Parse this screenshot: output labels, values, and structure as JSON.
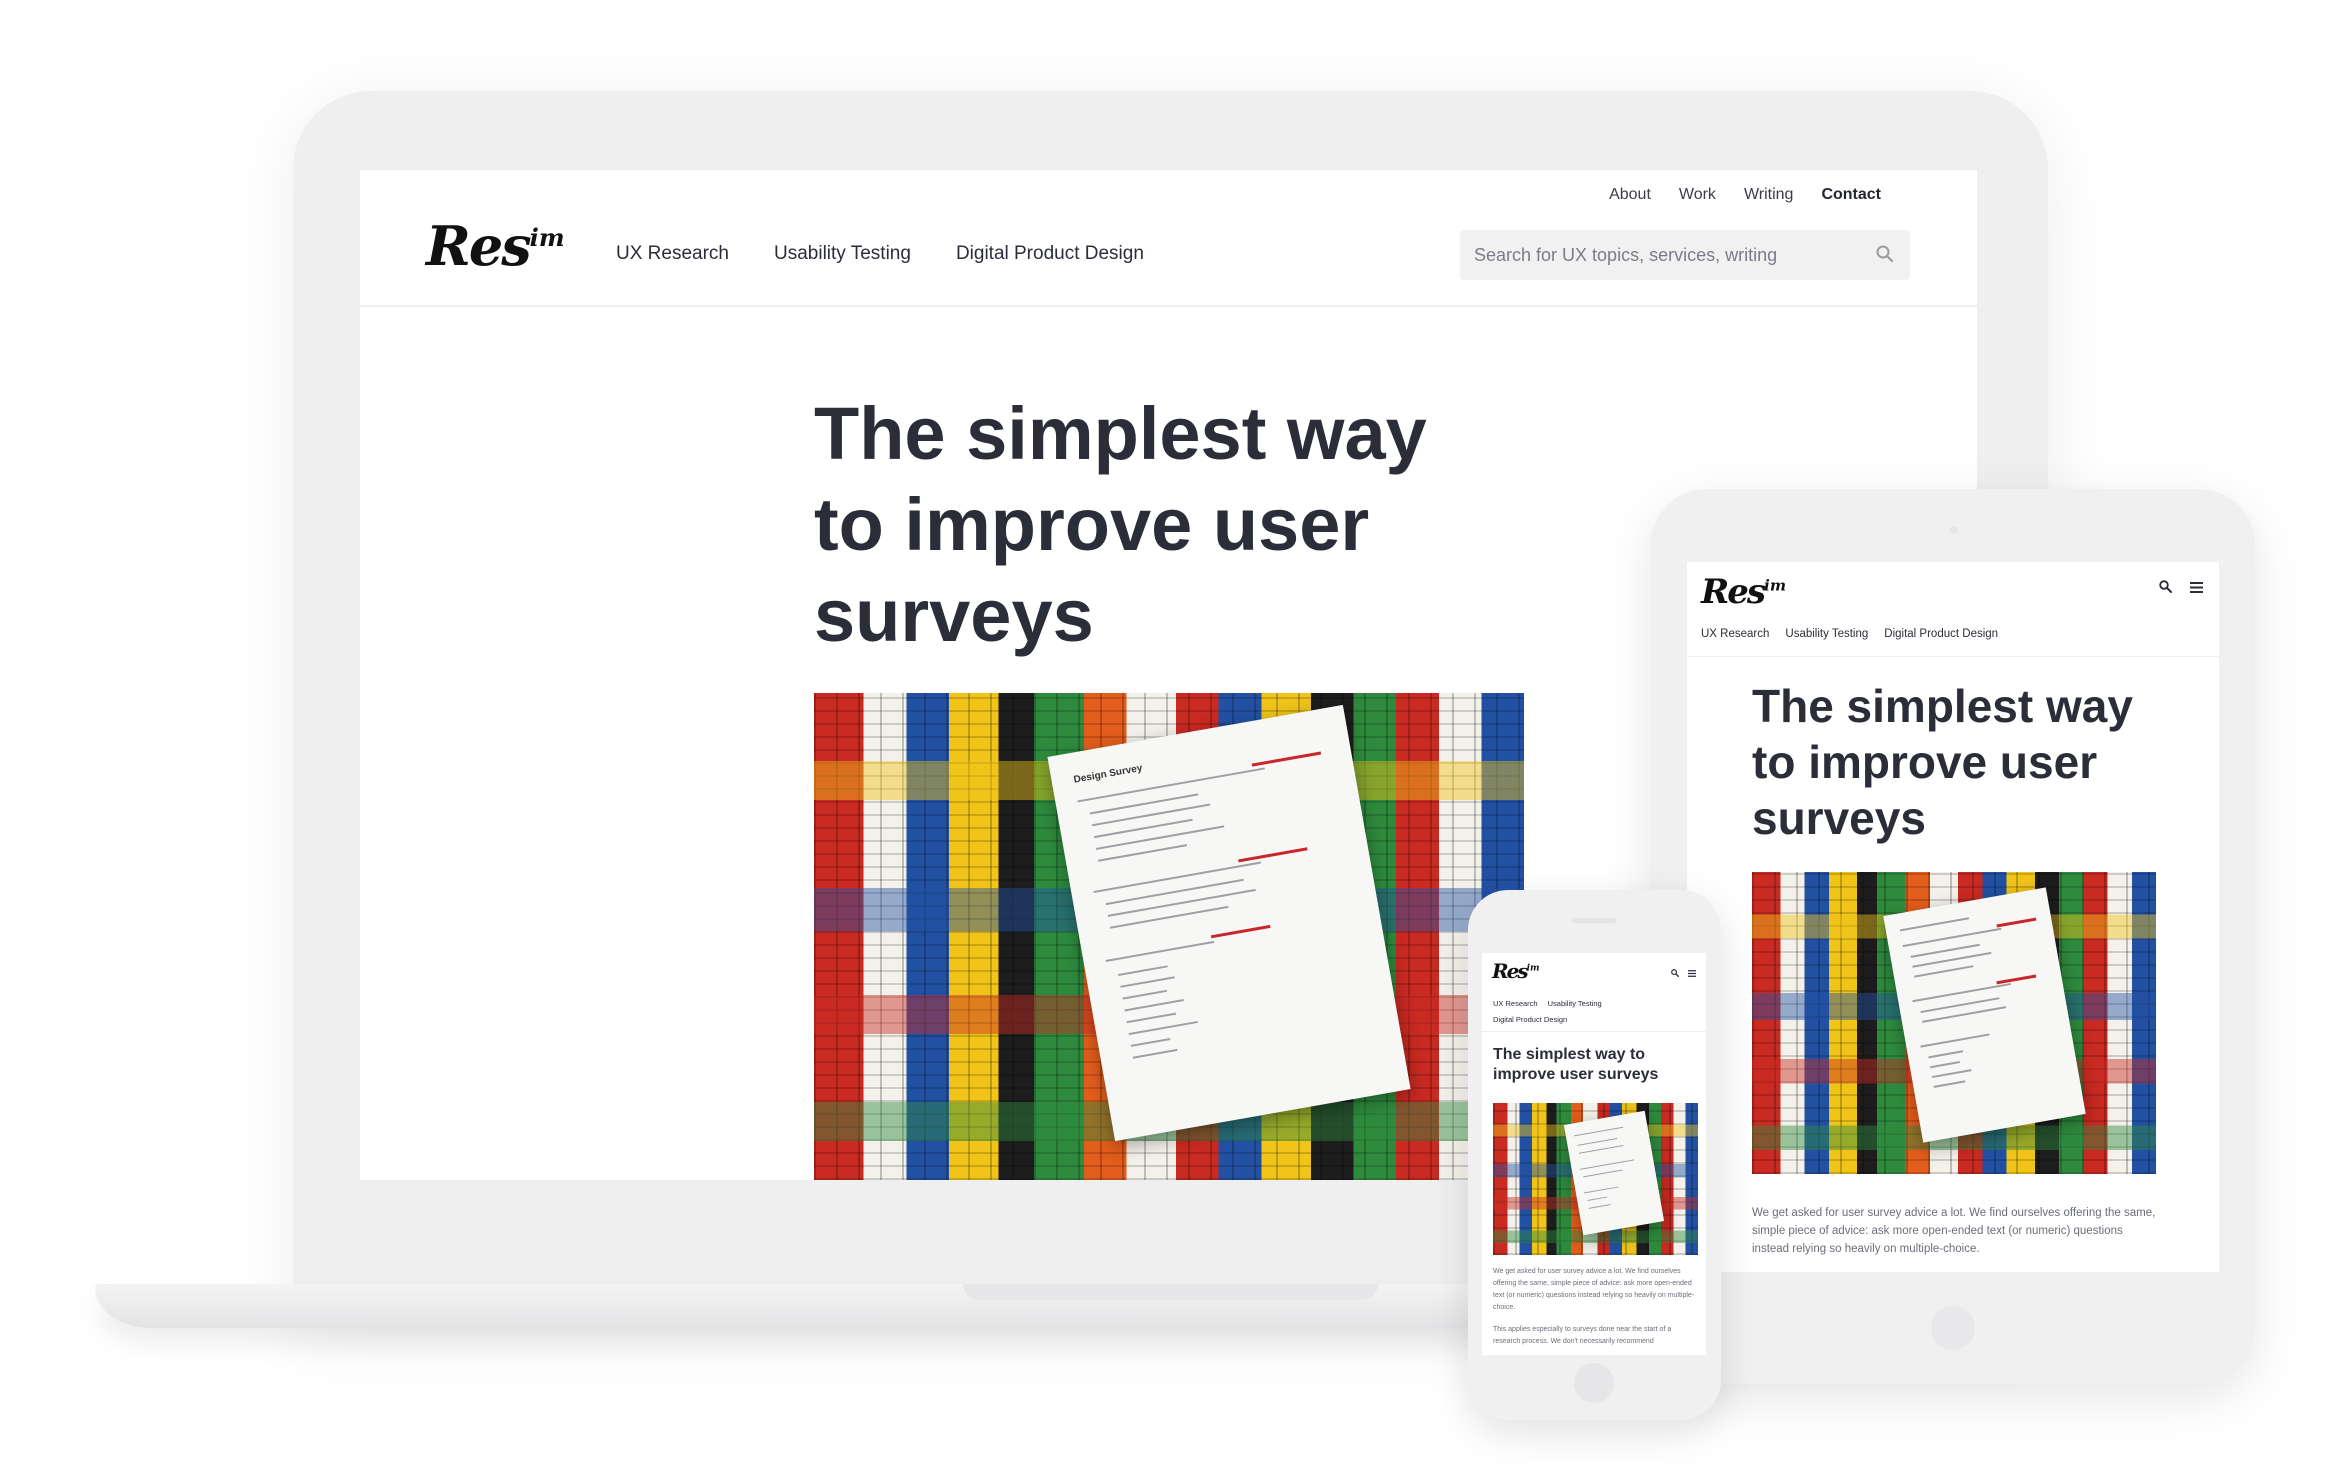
{
  "site": {
    "logo_text": "Res",
    "logo_suffix": "im"
  },
  "utility_nav": [
    "About",
    "Work",
    "Writing",
    "Contact"
  ],
  "main_nav": [
    "UX Research",
    "Usability Testing",
    "Digital Product Design"
  ],
  "search": {
    "placeholder": "Search for UX topics, services, writing"
  },
  "article": {
    "title": "The simplest way to improve user surveys",
    "paragraph_1": "We get asked for user survey advice a lot. We find ourselves offering the same, simple piece of advice: ask more open-ended text (or numeric) questions instead relying so heavily on multiple-choice.",
    "paragraph_2": "This applies especially to surveys done near the start of a research process. We don't necessarily recommend",
    "image": {
      "paper_heading": "Design Survey"
    }
  },
  "colors": {
    "heading": "#2b2e38",
    "device_frame": "#efeff0",
    "search_bg": "#f1f1f2"
  }
}
